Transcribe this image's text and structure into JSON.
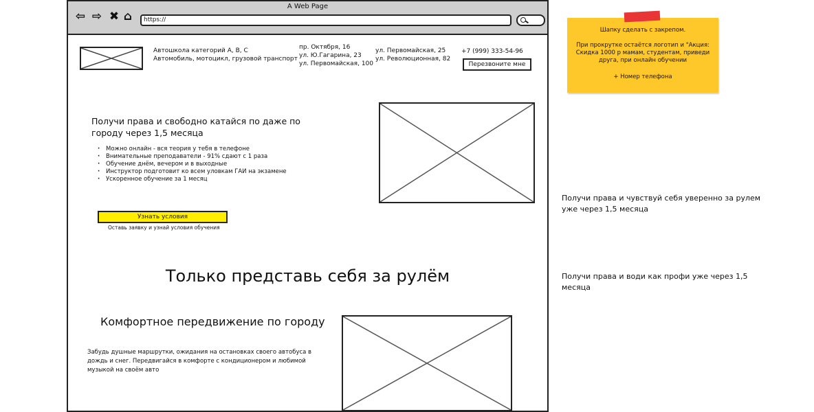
{
  "browser": {
    "window_title": "A Web Page",
    "url": "https://"
  },
  "header": {
    "school_line1": "Автошкола категорий А, В, С",
    "school_line2": "Автомобиль, мотоцикл, грузовой транспорт",
    "address_col1": [
      "пр. Октября, 16",
      "ул. Ю.Гагарина, 23",
      "ул. Первомайская, 100"
    ],
    "address_col2": [
      "ул. Первомайская, 25",
      "ул. Революционная, 82"
    ],
    "phone": "+7 (999) 333-54-96",
    "callback_label": "Перезвоните мне"
  },
  "hero": {
    "title_line1": "Получи права и свободно катайся по даже по",
    "title_line2": "городу через 1,5 месяца",
    "bullets": [
      "Можно онлайн - вся теория у тебя в телефоне",
      "Внимательные преподаватели - 91% сдают с 1 раза",
      "Обучение днём, вечером и в выходные",
      "Инструктор подготовит ко всем уловкам ГАИ на экзамене",
      "Ускоренное обучение за 1 месяц"
    ],
    "cta_label": "Узнать условия",
    "cta_note": "Оставь заявку и узнай условия обучения"
  },
  "imagine": {
    "heading": "Только представь себя за рулём"
  },
  "comfort": {
    "heading": "Комфортное передвижение по городу",
    "text_line1": "Забудь душные маршрутки, ожидания на остановках своего автобуса в",
    "text_line2": "дождь и снег. Передвигайся в комфорте с кондиционером и любимой",
    "text_line3": "музыкой на своём авто"
  },
  "sticky_note": {
    "line1": "Шапку сделать с закрепом.",
    "line2": "При прокрутке остаётся логотип и \"Акция:",
    "line3": "Скидка 1000 р мамам, студентам, приведи",
    "line4": "друга, при онлайн обучении",
    "line5": "+ Номер телефона"
  },
  "alt_headlines": {
    "alt1_line1": "Получи права и чувствуй себя уверенно за рулем",
    "alt1_line2": "уже через 1,5 месяца",
    "alt2_line1": "Получи права и води как профи уже через 1,5",
    "alt2_line2": "месяца"
  },
  "colors": {
    "cta_yellow": "#ffee00",
    "sticky_yellow": "#ffc82a",
    "tape_red": "#e83636",
    "chrome_gray": "#cfcfcf"
  },
  "icons": [
    "back-arrow-icon",
    "forward-arrow-icon",
    "close-icon",
    "home-icon",
    "search-icon"
  ]
}
